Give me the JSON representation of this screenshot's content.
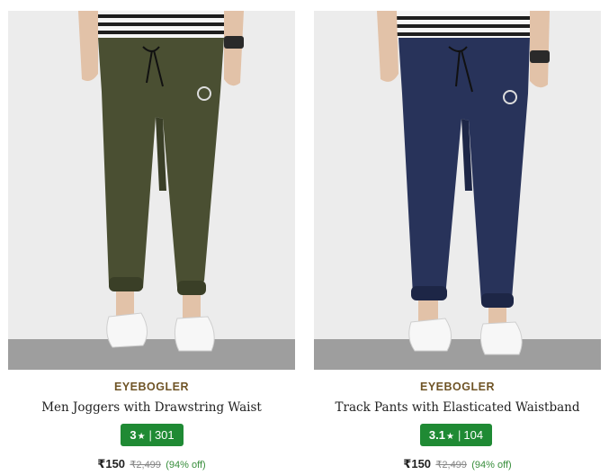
{
  "products": [
    {
      "brand": "EYEBOGLER",
      "title": "Men Joggers with Drawstring Waist",
      "rating": "3",
      "rating_count": "301",
      "price": "₹150",
      "mrp": "₹2,499",
      "discount": "(94% off)",
      "pant_color": "#4a4f32",
      "pant_shade": "#3a3f27"
    },
    {
      "brand": "EYEBOGLER",
      "title": "Track Pants with Elasticated Waistband",
      "rating": "3.1",
      "rating_count": "104",
      "price": "₹150",
      "mrp": "₹2,499",
      "discount": "(94% off)",
      "pant_color": "#28335a",
      "pant_shade": "#1d2646"
    }
  ],
  "symbols": {
    "star": "★",
    "separator": "|"
  },
  "colors": {
    "brand_text": "#6f5426",
    "rating_badge": "#1f8a34",
    "discount": "#388e3c"
  }
}
